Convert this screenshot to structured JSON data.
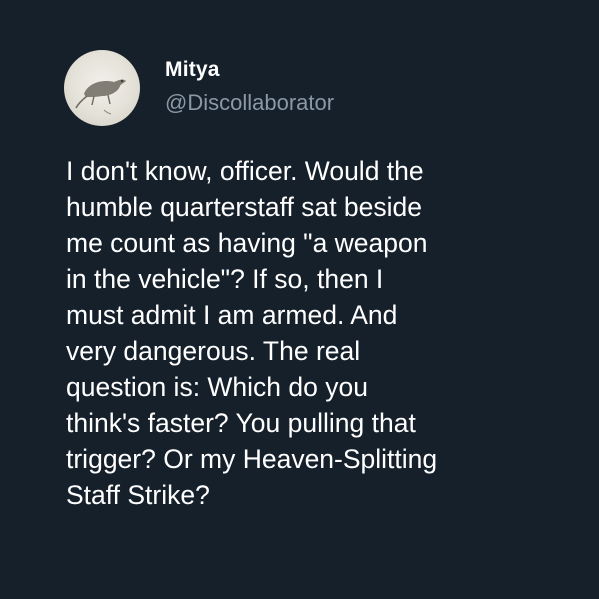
{
  "tweet": {
    "display_name": "Mitya",
    "handle": "@Discollaborator",
    "text": "I don't know, officer. Would the\nhumble quarterstaff sat beside\nme count as having \"a weapon\nin the vehicle\"? If so, then I\nmust admit I am armed. And\nvery dangerous. The real\nquestion is: Which do you\nthink's faster? You pulling that\ntrigger? Or my Heaven-Splitting\nStaff Strike?"
  },
  "theme": {
    "background": "#15202b",
    "text_color": "#ffffff",
    "handle_color": "#8b98a5"
  },
  "avatar": {
    "icon": "rat-sketch-avatar"
  }
}
